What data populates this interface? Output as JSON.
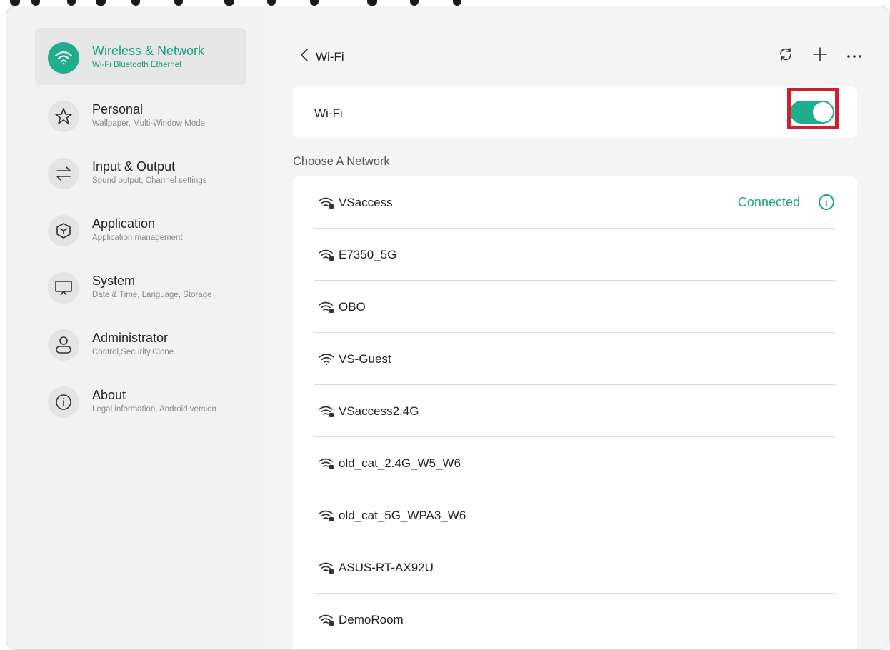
{
  "sidebar": {
    "items": [
      {
        "title": "Wireless & Network",
        "subtitle": "Wi-Fi Bluetooth Ethernet",
        "icon": "wifi-icon",
        "active": true
      },
      {
        "title": "Personal",
        "subtitle": "Wallpaper, Multi-Window Mode",
        "icon": "star-icon"
      },
      {
        "title": "Input & Output",
        "subtitle": "Sound output, Channel settings",
        "icon": "swap-arrows-icon"
      },
      {
        "title": "Application",
        "subtitle": "Application management",
        "icon": "cube-icon"
      },
      {
        "title": "System",
        "subtitle": "Date & Time, Language, Storage",
        "icon": "display-icon"
      },
      {
        "title": "Administrator",
        "subtitle": "Control,Security,Clone",
        "icon": "user-icon"
      },
      {
        "title": "About",
        "subtitle": "Legal information, Android version",
        "icon": "info-icon"
      }
    ]
  },
  "header": {
    "title": "Wi-Fi",
    "actions": [
      "refresh-icon",
      "plus-icon",
      "more-icon"
    ]
  },
  "wifi_toggle": {
    "label": "Wi-Fi",
    "enabled": true
  },
  "section_label": "Choose A Network",
  "networks": [
    {
      "name": "VSaccess",
      "status": "Connected",
      "locked": true
    },
    {
      "name": "E7350_5G",
      "locked": true
    },
    {
      "name": "OBO",
      "locked": true
    },
    {
      "name": "VS-Guest",
      "locked": false
    },
    {
      "name": "VSaccess2.4G",
      "locked": true
    },
    {
      "name": "old_cat_2.4G_W5_W6",
      "locked": true
    },
    {
      "name": "old_cat_5G_WPA3_W6",
      "locked": true
    },
    {
      "name": "ASUS-RT-AX92U",
      "locked": true
    },
    {
      "name": "DemoRoom",
      "locked": true
    }
  ],
  "colors": {
    "accent": "#20ad8c",
    "highlight": "#d0202b",
    "sidebar_bg": "#f2f2f2",
    "content_bg": "#f4f4f4"
  }
}
